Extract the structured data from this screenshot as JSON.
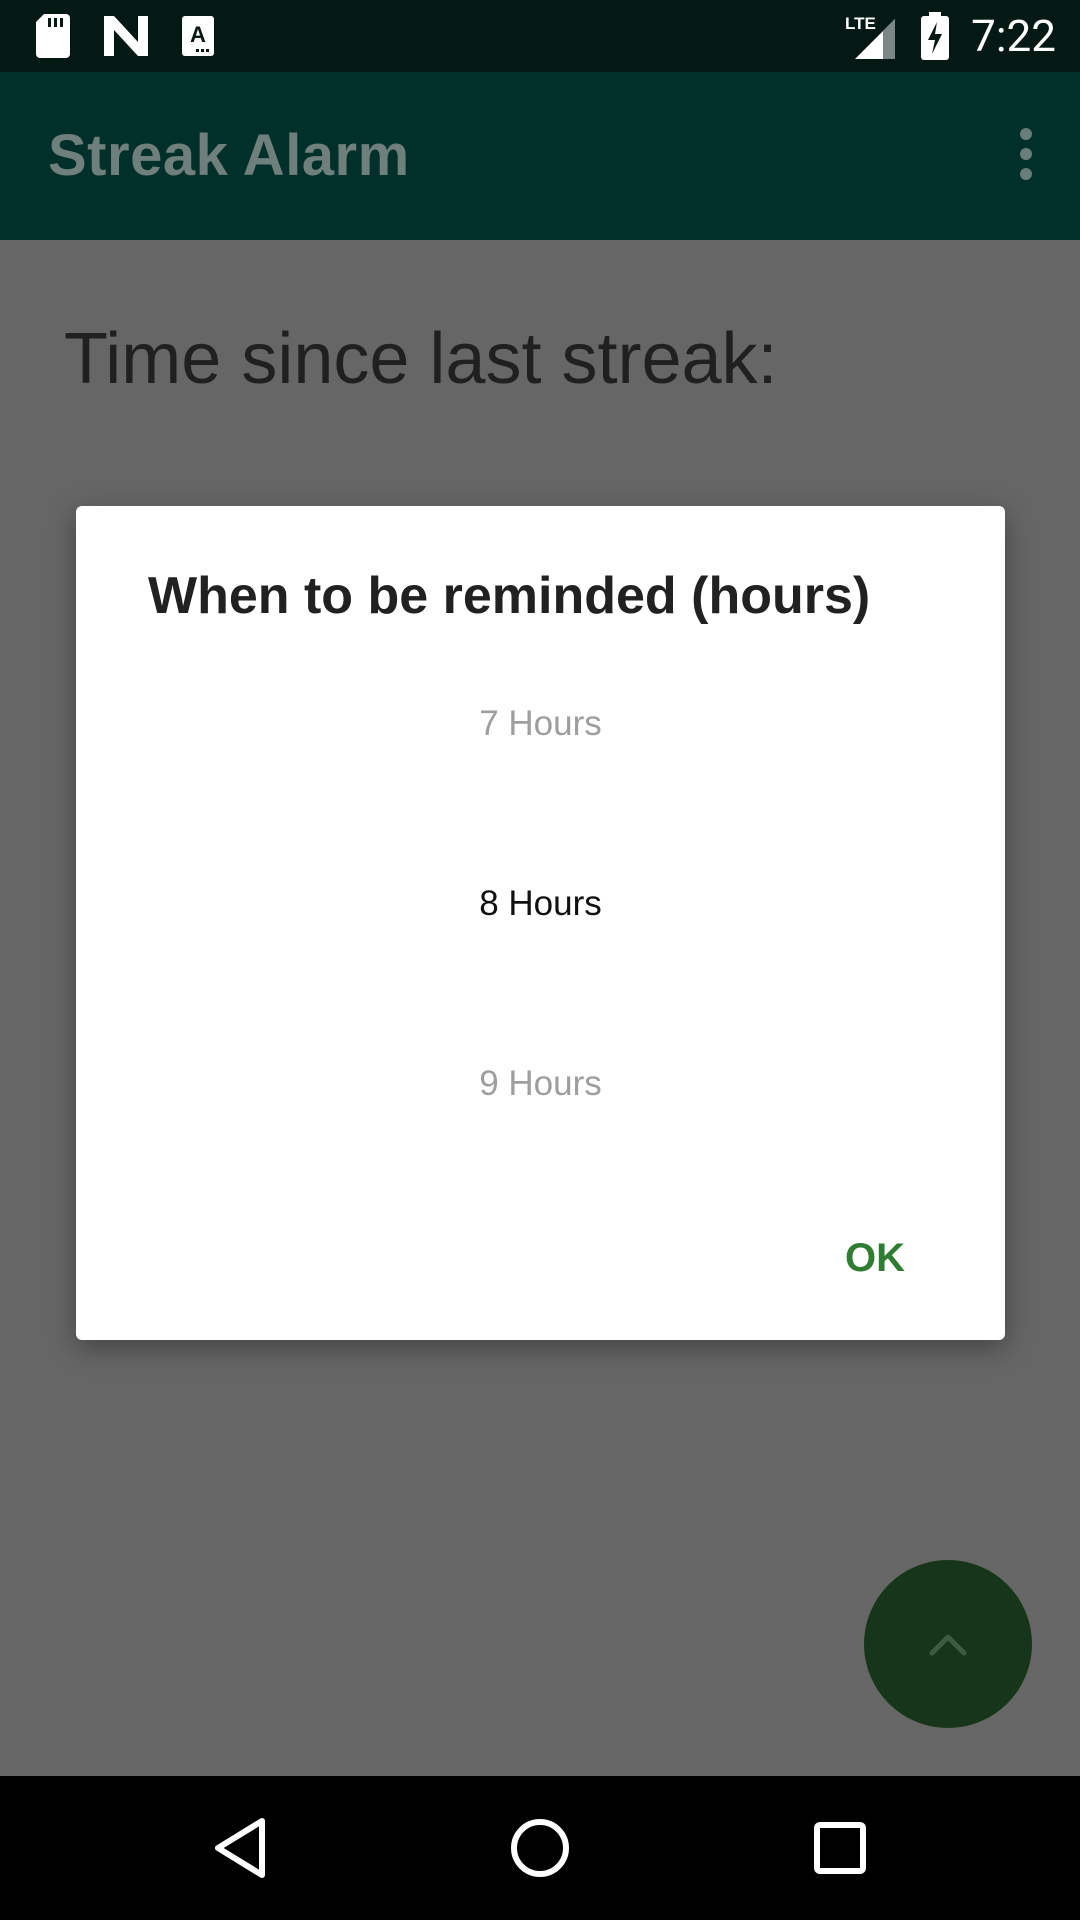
{
  "status_bar": {
    "time": "7:22",
    "network": "LTE",
    "icons": [
      "sd-card-icon",
      "n-logo-icon",
      "text-a-icon",
      "signal-icon",
      "battery-charging-icon"
    ]
  },
  "app_bar": {
    "title": "Streak Alarm",
    "menu_icon": "overflow-menu-icon"
  },
  "main": {
    "headline": "Time since last streak:"
  },
  "dialog": {
    "title": "When to be reminded (hours)",
    "picker": {
      "previous": "7 Hours",
      "selected": "8 Hours",
      "next": "9 Hours"
    },
    "ok_label": "OK"
  },
  "fab": {
    "icon": "chevron-up-icon"
  },
  "nav_bar": {
    "icons": [
      "back-icon",
      "home-icon",
      "recents-icon"
    ]
  },
  "colors": {
    "status_bar": "#041814",
    "app_bar": "#01302a",
    "scrim_background": "#666666",
    "accent_green": "#2e7d32",
    "fab": "#17351a"
  }
}
